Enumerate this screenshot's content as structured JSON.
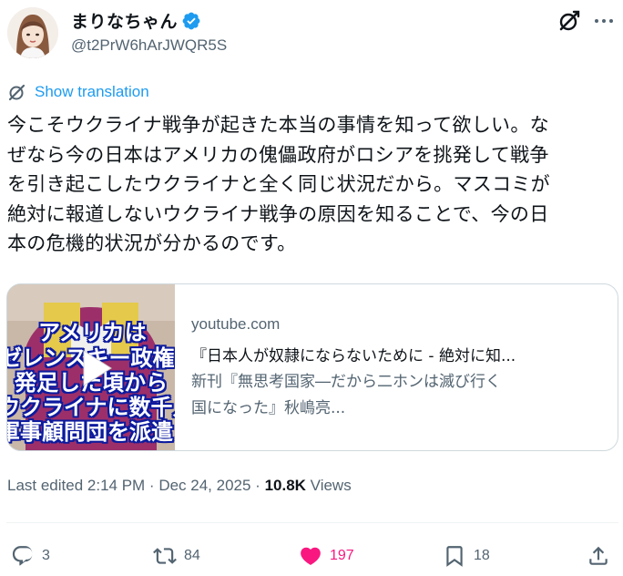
{
  "author": {
    "display_name": "まりなちゃん",
    "handle": "@t2PrW6hArJWQR5S",
    "verified": true
  },
  "translate_label": "Show translation",
  "tweet": {
    "lines": [
      "今こそウクライナ戦争が起きた本当の事情を知って欲しい。な",
      "ぜなら今の日本はアメリカの傀儡政府がロシアを挑発して戦争",
      "を引き起こしたウクライナと全く同じ状況だから。マスコミが",
      "絶対に報道しないウクライナ戦争の原因を知ることで、今の日",
      "本の危機的状況が分かるのです。"
    ]
  },
  "card": {
    "domain": "youtube.com",
    "title": "『日本人が奴隷にならないために - 絶対に知...",
    "desc_lines": [
      "新刊『無思考国家―だから二ホンは滅び行く",
      "国になった』秋嶋亮..."
    ],
    "thumbnail_text": [
      "アメリカは",
      "ゼレンスキー政権が",
      "発足した頃から",
      "ウクライナに数千人",
      "軍事顧問団を派遣"
    ]
  },
  "meta": {
    "edited": "Last edited 2:14 PM · Dec 24, 2025 · ",
    "views_count": "10.8K",
    "views_label": " Views"
  },
  "actions": {
    "replies": "3",
    "reposts": "84",
    "likes": "197",
    "bookmarks": "18"
  },
  "colors": {
    "accent": "#1d9bf0",
    "like": "#f91880",
    "muted": "#536471",
    "text": "#0f1419"
  }
}
